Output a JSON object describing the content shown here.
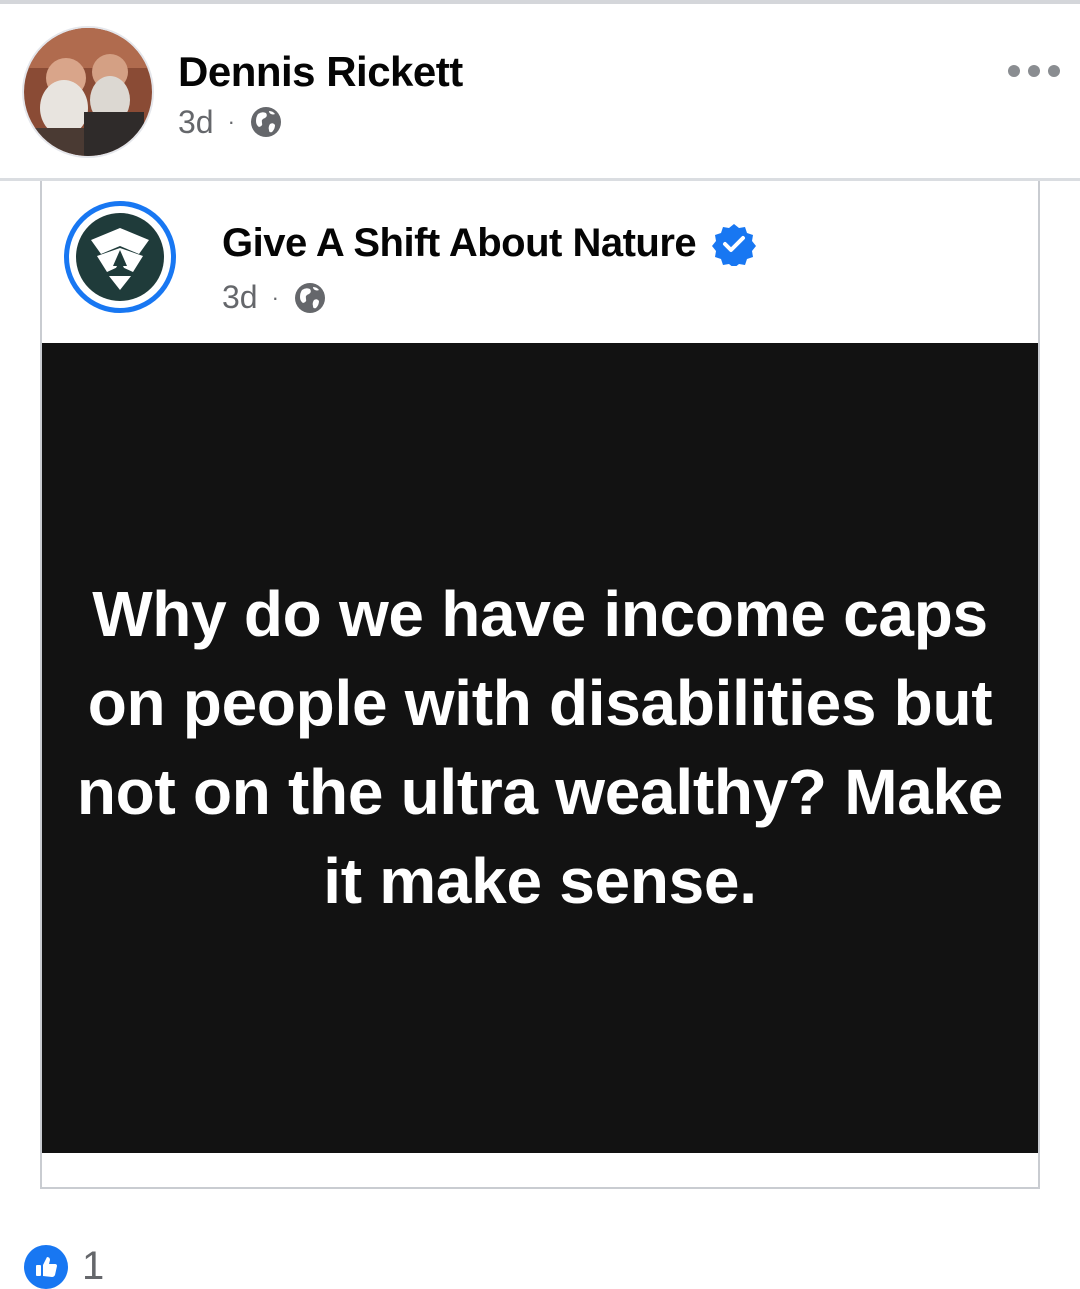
{
  "post": {
    "author": "Dennis Rickett",
    "time": "3d",
    "separator": "·",
    "privacy_icon": "globe-icon",
    "more_icon": "more-options-icon"
  },
  "shared": {
    "page_name": "Give A Shift About Nature",
    "verified_icon": "verified-badge-icon",
    "time": "3d",
    "separator": "·",
    "privacy_icon": "globe-icon",
    "text": "Why do we have income caps on people with disabilities but not on the ultra wealthy? Make it make sense."
  },
  "reactions": {
    "icon": "like-icon",
    "count": "1"
  },
  "colors": {
    "accent": "#1877f2",
    "quote_background": "#121212",
    "secondary_text": "#65676b"
  }
}
